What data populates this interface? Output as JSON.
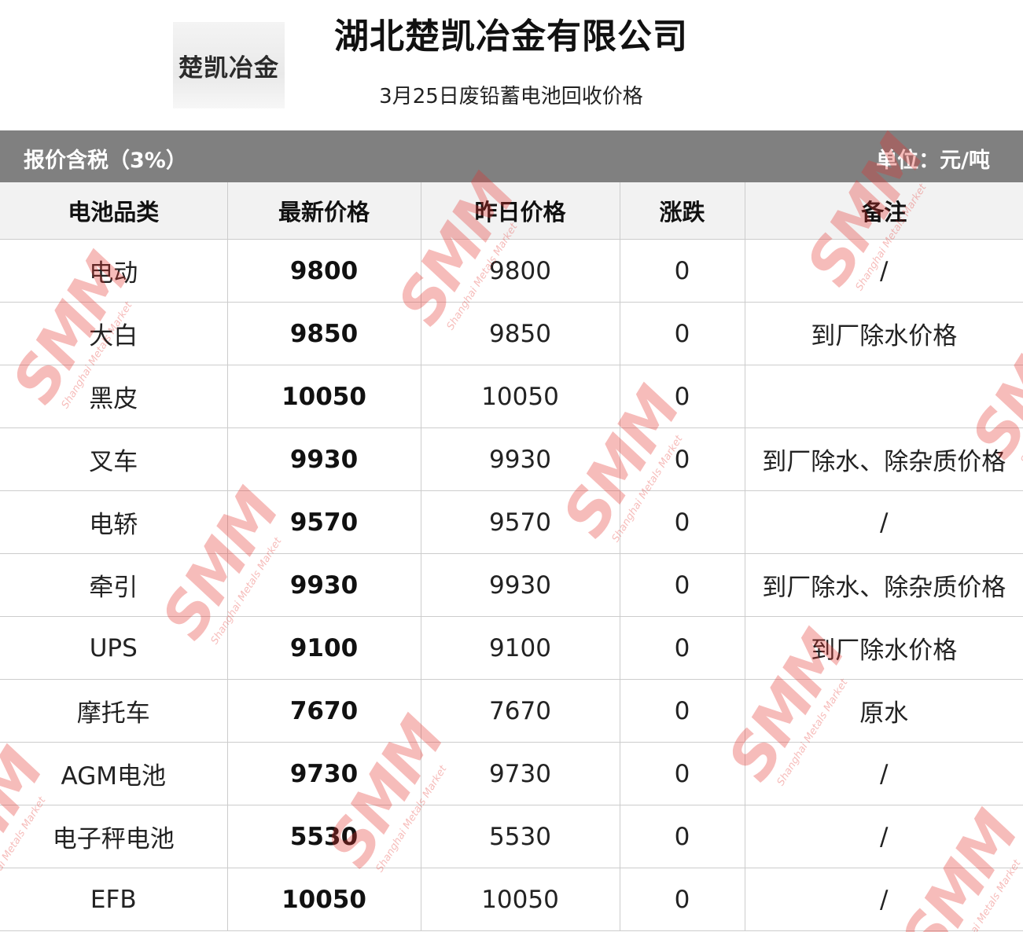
{
  "header": {
    "logo_text": "楚凯冶金",
    "company": "湖北楚凯冶金有限公司",
    "subtitle": "3月25日废铅蓄电池回收价格"
  },
  "band": {
    "left": "报价含税（3%）",
    "right": "单位：元/吨"
  },
  "table": {
    "columns": [
      "电池品类",
      "最新价格",
      "昨日价格",
      "涨跌",
      "备注"
    ],
    "rows": [
      {
        "category": "电动",
        "latest": "9800",
        "yesterday": "9800",
        "change": "0",
        "note": "/"
      },
      {
        "category": "大白",
        "latest": "9850",
        "yesterday": "9850",
        "change": "0",
        "note": "到厂除水价格"
      },
      {
        "category": "黑皮",
        "latest": "10050",
        "yesterday": "10050",
        "change": "0",
        "note": ""
      },
      {
        "category": "叉车",
        "latest": "9930",
        "yesterday": "9930",
        "change": "0",
        "note": "到厂除水、除杂质价格"
      },
      {
        "category": "电轿",
        "latest": "9570",
        "yesterday": "9570",
        "change": "0",
        "note": "/"
      },
      {
        "category": "牵引",
        "latest": "9930",
        "yesterday": "9930",
        "change": "0",
        "note": "到厂除水、除杂质价格"
      },
      {
        "category": "UPS",
        "latest": "9100",
        "yesterday": "9100",
        "change": "0",
        "note": "到厂除水价格"
      },
      {
        "category": "摩托车",
        "latest": "7670",
        "yesterday": "7670",
        "change": "0",
        "note": "原水"
      },
      {
        "category": "AGM电池",
        "latest": "9730",
        "yesterday": "9730",
        "change": "0",
        "note": "/"
      },
      {
        "category": "电子秤电池",
        "latest": "5530",
        "yesterday": "5530",
        "change": "0",
        "note": "/"
      },
      {
        "category": "EFB",
        "latest": "10050",
        "yesterday": "10050",
        "change": "0",
        "note": "/"
      }
    ]
  },
  "watermark": {
    "mark": "SMM",
    "tagline": "Shanghai Metals Market",
    "color": "#e5322d"
  }
}
